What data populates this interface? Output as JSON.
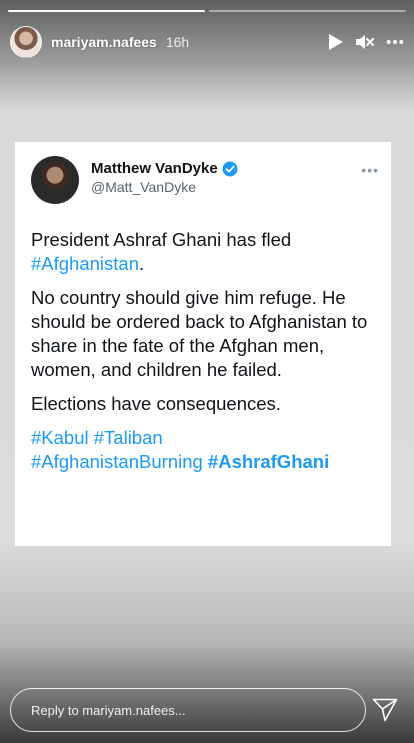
{
  "story": {
    "username": "mariyam.nafees",
    "timestamp": "16h",
    "progress": [
      1.0,
      0.0
    ],
    "icons": {
      "play": "play-icon",
      "mute": "speaker-muted-icon",
      "more": "more-options-icon",
      "send": "send-icon"
    },
    "reply_placeholder": "Reply to mariyam.nafees..."
  },
  "tweet": {
    "author_name": "Matthew VanDyke",
    "handle": "@Matt_VanDyke",
    "verified": true,
    "more": "•••",
    "line1_text": "President Ashraf Ghani has fled",
    "line1_hashtag": "#Afghanistan",
    "line1_end": ".",
    "paragraph2": "No country should give him refuge. He should be ordered back to Afghanistan to share in the fate of the Afghan men, women, and children he failed.",
    "paragraph3": "Elections have consequences.",
    "hashtags": [
      "#Kabul",
      "#Taliban",
      "#AfghanistanBurning",
      "#AshrafGhani"
    ]
  },
  "colors": {
    "link": "#1d9bf0",
    "verified": "#1d9bf0",
    "text": "#0f1419",
    "handle": "#536471"
  }
}
